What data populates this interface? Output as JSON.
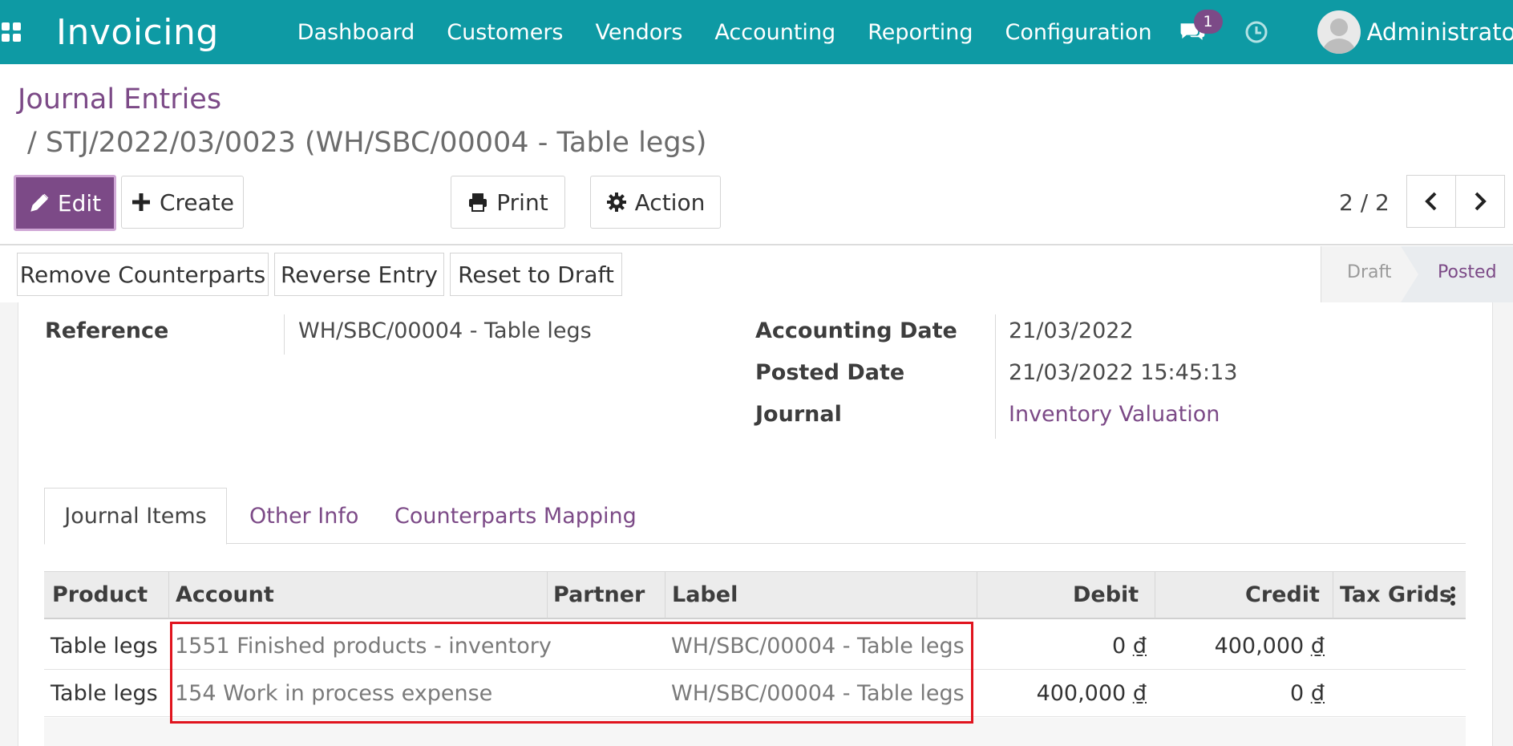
{
  "navbar": {
    "app_title": "Invoicing",
    "menu": [
      "Dashboard",
      "Customers",
      "Vendors",
      "Accounting",
      "Reporting",
      "Configuration"
    ],
    "chat_badge": "1",
    "user_name": "Administrator"
  },
  "breadcrumb": {
    "root": "Journal Entries",
    "current": "/  STJ/2022/03/0023 (WH/SBC/00004 - Table legs)"
  },
  "toolbar": {
    "edit_label": "Edit",
    "create_label": "Create",
    "print_label": "Print",
    "action_label": "Action",
    "pager": "2 / 2"
  },
  "statusbar": {
    "buttons": [
      "Remove Counterparts",
      "Reverse Entry",
      "Reset to Draft"
    ],
    "stages": [
      "Draft",
      "Posted"
    ],
    "active_stage": "Posted"
  },
  "form": {
    "reference_label": "Reference",
    "reference_value": "WH/SBC/00004 - Table legs",
    "accounting_date_label": "Accounting Date",
    "accounting_date_value": "21/03/2022",
    "posted_date_label": "Posted Date",
    "posted_date_value": "21/03/2022 15:45:13",
    "journal_label": "Journal",
    "journal_value": "Inventory Valuation"
  },
  "tabs": [
    "Journal Items",
    "Other Info",
    "Counterparts Mapping"
  ],
  "table": {
    "columns": [
      "Product",
      "Account",
      "Partner",
      "Label",
      "Debit",
      "Credit",
      "Tax Grids"
    ],
    "rows": [
      {
        "product": "Table legs",
        "account": "1551 Finished products - inventory",
        "partner": "",
        "label": "WH/SBC/00004 - Table legs",
        "debit": "0",
        "credit": "400,000"
      },
      {
        "product": "Table legs",
        "account": "154 Work in process expense",
        "partner": "",
        "label": "WH/SBC/00004 - Table legs",
        "debit": "400,000",
        "credit": "0"
      }
    ],
    "currency_symbol": "₫"
  },
  "colors": {
    "navbar": "#0e9aa4",
    "primary": "#7c4a87",
    "highlight": "#e0141e"
  }
}
